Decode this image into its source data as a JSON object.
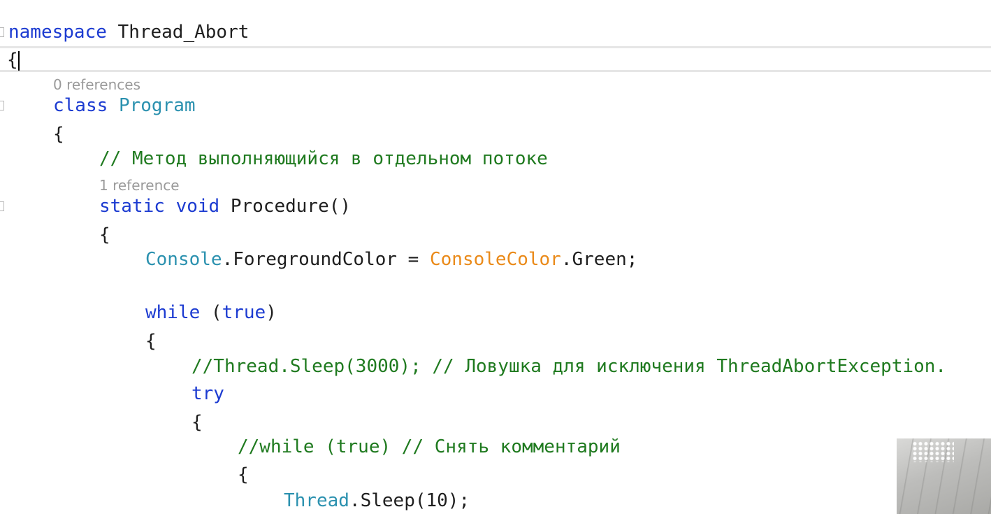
{
  "editor": {
    "lines": [
      {
        "id": "ln-namespace",
        "tokens": [
          {
            "t": "namespace",
            "c": "kw"
          },
          {
            "t": " Thread_Abort",
            "c": "pl"
          }
        ]
      },
      {
        "id": "ln-open-ns",
        "tokens": [
          {
            "t": "{",
            "c": "pl"
          }
        ]
      },
      {
        "id": "ln-class",
        "tokens": [
          {
            "t": "class",
            "c": "kw"
          },
          {
            "t": " ",
            "c": "pl"
          },
          {
            "t": "Program",
            "c": "ty"
          }
        ]
      },
      {
        "id": "ln-open-class",
        "tokens": [
          {
            "t": "{",
            "c": "pl"
          }
        ]
      },
      {
        "id": "ln-comment-method",
        "tokens": [
          {
            "t": "// Метод выполняющийся в отдельном потоке",
            "c": "cm"
          }
        ]
      },
      {
        "id": "ln-method",
        "tokens": [
          {
            "t": "static",
            "c": "kw"
          },
          {
            "t": " ",
            "c": "pl"
          },
          {
            "t": "void",
            "c": "kw"
          },
          {
            "t": " Procedure()",
            "c": "pl"
          }
        ]
      },
      {
        "id": "ln-open-method",
        "tokens": [
          {
            "t": "{",
            "c": "pl"
          }
        ]
      },
      {
        "id": "ln-console",
        "tokens": [
          {
            "t": "Console",
            "c": "ty"
          },
          {
            "t": ".ForegroundColor = ",
            "c": "pl"
          },
          {
            "t": "ConsoleColor",
            "c": "en"
          },
          {
            "t": ".Green;",
            "c": "pl"
          }
        ]
      },
      {
        "id": "ln-while",
        "tokens": [
          {
            "t": "while",
            "c": "kw"
          },
          {
            "t": " (",
            "c": "pl"
          },
          {
            "t": "true",
            "c": "kw"
          },
          {
            "t": ")",
            "c": "pl"
          }
        ]
      },
      {
        "id": "ln-open-while",
        "tokens": [
          {
            "t": "{",
            "c": "pl"
          }
        ]
      },
      {
        "id": "ln-comment-sleep",
        "tokens": [
          {
            "t": "//Thread.Sleep(3000); // Ловушка для исключения ThreadAbortException.",
            "c": "cm"
          }
        ]
      },
      {
        "id": "ln-try",
        "tokens": [
          {
            "t": "try",
            "c": "kw"
          }
        ]
      },
      {
        "id": "ln-open-try",
        "tokens": [
          {
            "t": "{",
            "c": "pl"
          }
        ]
      },
      {
        "id": "ln-comment-while",
        "tokens": [
          {
            "t": "//while (true) // Снять комментарий",
            "c": "cm"
          }
        ]
      },
      {
        "id": "ln-open-inner",
        "tokens": [
          {
            "t": "{",
            "c": "pl"
          }
        ]
      },
      {
        "id": "ln-thread-sleep",
        "tokens": [
          {
            "t": "Thread",
            "c": "ty"
          },
          {
            "t": ".Sleep(10);",
            "c": "pl"
          }
        ]
      }
    ],
    "codelens": {
      "class_refs": "0 references",
      "method_refs": "1 reference"
    }
  },
  "colors": {
    "keyword": "#1c3bd1",
    "type": "#2b91af",
    "enum": "#ea8a19",
    "comment": "#1f7a1f",
    "plain": "#1e1e1e",
    "codelens": "#9a9a9a",
    "current_line_border": "#e6e6e6"
  }
}
